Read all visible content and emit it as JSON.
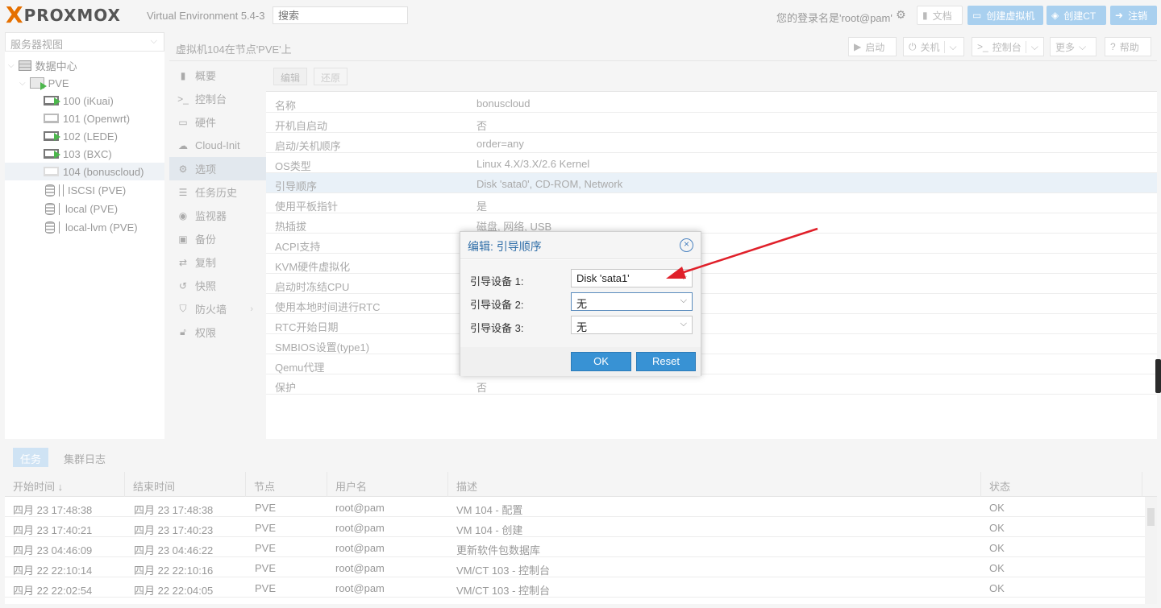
{
  "topbar": {
    "logo_x": "X",
    "logo_text": "PROXMOX",
    "version": "Virtual Environment 5.4-3",
    "search_placeholder": "搜索",
    "login_text": "您的登录名是'root@pam'",
    "docs_label": "文档",
    "create_vm_label": "创建虚拟机",
    "create_ct_label": "创建CT",
    "logout_label": "注销"
  },
  "tree": {
    "view_label": "服务器视图",
    "nodes": [
      {
        "label": "数据中心"
      },
      {
        "label": "PVE"
      },
      {
        "label": "100 (iKuai)"
      },
      {
        "label": "101 (Openwrt)"
      },
      {
        "label": "102 (LEDE)"
      },
      {
        "label": "103 (BXC)"
      },
      {
        "label": "104 (bonuscloud)"
      },
      {
        "label": "ISCSI (PVE)"
      },
      {
        "label": "local (PVE)"
      },
      {
        "label": "local-lvm (PVE)"
      }
    ]
  },
  "header": {
    "title": "虚拟机104在节点'PVE'上",
    "start_label": "启动",
    "shutdown_label": "关机",
    "console_label": "控制台",
    "more_label": "更多",
    "help_label": "帮助"
  },
  "menu": {
    "items": [
      {
        "label": "概要",
        "icon": "book-icon"
      },
      {
        "label": "控制台",
        "icon": "terminal-icon"
      },
      {
        "label": "硬件",
        "icon": "desktop-icon"
      },
      {
        "label": "Cloud-Init",
        "icon": "cloud-icon"
      },
      {
        "label": "选项",
        "icon": "gear-icon"
      },
      {
        "label": "任务历史",
        "icon": "list-icon"
      },
      {
        "label": "监视器",
        "icon": "eye-icon"
      },
      {
        "label": "备份",
        "icon": "floppy-icon"
      },
      {
        "label": "复制",
        "icon": "retweet-icon"
      },
      {
        "label": "快照",
        "icon": "history-icon"
      },
      {
        "label": "防火墙",
        "icon": "shield-icon"
      },
      {
        "label": "权限",
        "icon": "unlock-icon"
      }
    ]
  },
  "toolbar": {
    "edit_label": "编辑",
    "revert_label": "还原"
  },
  "options": [
    {
      "key": "名称",
      "value": "bonuscloud"
    },
    {
      "key": "开机自启动",
      "value": "否"
    },
    {
      "key": "启动/关机顺序",
      "value": "order=any"
    },
    {
      "key": "OS类型",
      "value": "Linux 4.X/3.X/2.6 Kernel"
    },
    {
      "key": "引导顺序",
      "value": "Disk 'sata0', CD-ROM, Network"
    },
    {
      "key": "使用平板指针",
      "value": "是"
    },
    {
      "key": "热插拔",
      "value": "磁盘, 网络, USB"
    },
    {
      "key": "ACPI支持",
      "value": ""
    },
    {
      "key": "KVM硬件虚拟化",
      "value": ""
    },
    {
      "key": "启动时冻结CPU",
      "value": ""
    },
    {
      "key": "使用本地时间进行RTC",
      "value": ""
    },
    {
      "key": "RTC开始日期",
      "value": ""
    },
    {
      "key": "SMBIOS设置(type1)",
      "value": ""
    },
    {
      "key": "Qemu代理",
      "value": ""
    },
    {
      "key": "保护",
      "value": "否"
    }
  ],
  "dialog": {
    "title": "编辑: 引导顺序",
    "close_symbol": "×",
    "fields": [
      {
        "label": "引导设备 1:",
        "value": "Disk 'sata1'"
      },
      {
        "label": "引导设备 2:",
        "value": "无"
      },
      {
        "label": "引导设备 3:",
        "value": "无"
      }
    ],
    "ok_label": "OK",
    "reset_label": "Reset"
  },
  "tasks": {
    "tab_tasks": "任务",
    "tab_cluster_log": "集群日志",
    "columns": [
      "开始时间 ↓",
      "结束时间",
      "节点",
      "用户名",
      "描述",
      "状态"
    ],
    "rows": [
      [
        "四月 23 17:48:38",
        "四月 23 17:48:38",
        "PVE",
        "root@pam",
        "VM 104 - 配置",
        "OK"
      ],
      [
        "四月 23 17:40:21",
        "四月 23 17:40:23",
        "PVE",
        "root@pam",
        "VM 104 - 创建",
        "OK"
      ],
      [
        "四月 23 04:46:09",
        "四月 23 04:46:22",
        "PVE",
        "root@pam",
        "更新软件包数据库",
        "OK"
      ],
      [
        "四月 22 22:10:14",
        "四月 22 22:10:16",
        "PVE",
        "root@pam",
        "VM/CT 103 - 控制台",
        "OK"
      ],
      [
        "四月 22 22:02:54",
        "四月 22 22:04:05",
        "PVE",
        "root@pam",
        "VM/CT 103 - 控制台",
        "OK"
      ]
    ]
  },
  "colors": {
    "brand_orange": "#e57000",
    "primary_blue": "#3892d4",
    "annotation_red": "#e0202a"
  }
}
